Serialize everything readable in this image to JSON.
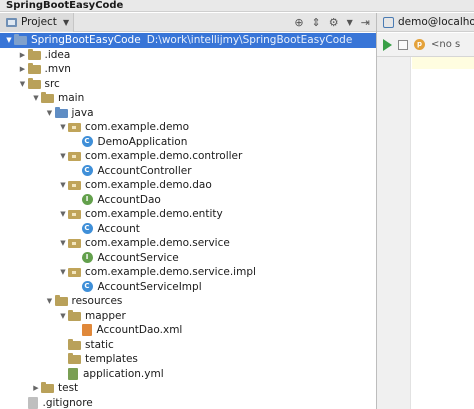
{
  "window": {
    "title": "SpringBootEasyCode"
  },
  "project_panel": {
    "tab_label": "Project",
    "tools": [
      "target-icon",
      "split-icon",
      "gear-icon",
      "hide-icon"
    ]
  },
  "tree": [
    {
      "label": "SpringBootEasyCode",
      "path": "D:\\work\\intellijmy\\SpringBootEasyCode",
      "depth": 0,
      "arrow": "down",
      "icon": "module-folder",
      "selected": true
    },
    {
      "label": ".idea",
      "depth": 1,
      "arrow": "right",
      "icon": "folder"
    },
    {
      "label": ".mvn",
      "depth": 1,
      "arrow": "right",
      "icon": "folder"
    },
    {
      "label": "src",
      "depth": 1,
      "arrow": "down",
      "icon": "folder"
    },
    {
      "label": "main",
      "depth": 2,
      "arrow": "down",
      "icon": "folder"
    },
    {
      "label": "java",
      "depth": 3,
      "arrow": "down",
      "icon": "source-folder"
    },
    {
      "label": "com.example.demo",
      "depth": 4,
      "arrow": "down",
      "icon": "package"
    },
    {
      "label": "DemoApplication",
      "depth": 5,
      "arrow": "",
      "icon": "class"
    },
    {
      "label": "com.example.demo.controller",
      "depth": 4,
      "arrow": "down",
      "icon": "package"
    },
    {
      "label": "AccountController",
      "depth": 5,
      "arrow": "",
      "icon": "class"
    },
    {
      "label": "com.example.demo.dao",
      "depth": 4,
      "arrow": "down",
      "icon": "package"
    },
    {
      "label": "AccountDao",
      "depth": 5,
      "arrow": "",
      "icon": "interface"
    },
    {
      "label": "com.example.demo.entity",
      "depth": 4,
      "arrow": "down",
      "icon": "package"
    },
    {
      "label": "Account",
      "depth": 5,
      "arrow": "",
      "icon": "class"
    },
    {
      "label": "com.example.demo.service",
      "depth": 4,
      "arrow": "down",
      "icon": "package"
    },
    {
      "label": "AccountService",
      "depth": 5,
      "arrow": "",
      "icon": "interface"
    },
    {
      "label": "com.example.demo.service.impl",
      "depth": 4,
      "arrow": "down",
      "icon": "package"
    },
    {
      "label": "AccountServiceImpl",
      "depth": 5,
      "arrow": "",
      "icon": "class"
    },
    {
      "label": "resources",
      "depth": 3,
      "arrow": "down",
      "icon": "resources-folder"
    },
    {
      "label": "mapper",
      "depth": 4,
      "arrow": "down",
      "icon": "folder"
    },
    {
      "label": "AccountDao.xml",
      "depth": 5,
      "arrow": "",
      "icon": "xml-file"
    },
    {
      "label": "static",
      "depth": 4,
      "arrow": "",
      "icon": "folder"
    },
    {
      "label": "templates",
      "depth": 4,
      "arrow": "",
      "icon": "folder"
    },
    {
      "label": "application.yml",
      "depth": 4,
      "arrow": "",
      "icon": "yml-file"
    },
    {
      "label": "test",
      "depth": 2,
      "arrow": "right",
      "icon": "folder"
    },
    {
      "label": ".gitignore",
      "depth": 1,
      "arrow": "",
      "icon": "file"
    }
  ],
  "editor": {
    "tab_label": "demo@localho",
    "session_text": "<no s"
  }
}
